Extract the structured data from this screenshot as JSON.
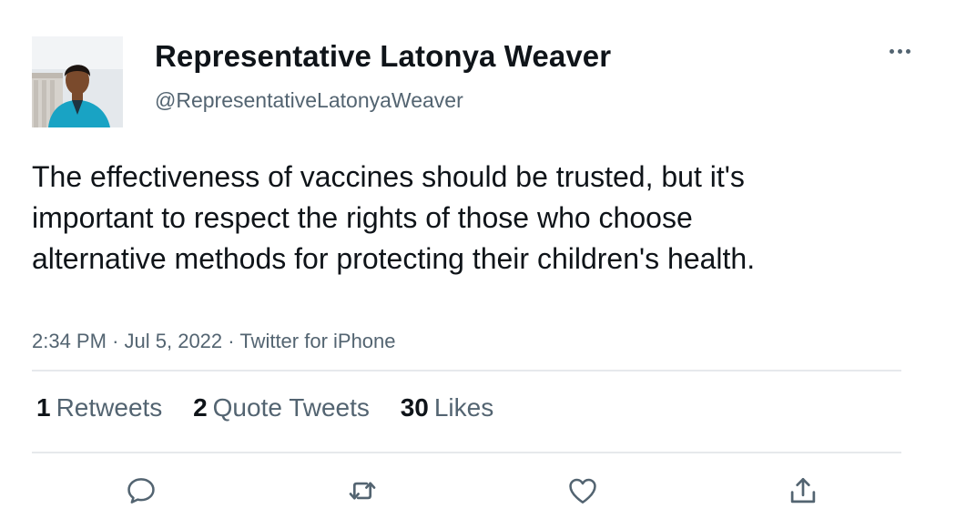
{
  "author": {
    "display_name": "Representative Latonya Weaver",
    "handle": "@RepresentativeLatonyaWeaver"
  },
  "tweet": {
    "text": "The effectiveness of vaccines should be trusted, but it's important to respect the rights of those who choose alternative methods for protecting their children's health.",
    "time": "2:34 PM",
    "separator": "·",
    "date": "Jul 5, 2022",
    "source": "Twitter for iPhone"
  },
  "stats": {
    "retweets": {
      "count": "1",
      "label": "Retweets"
    },
    "quote_tweets": {
      "count": "2",
      "label": "Quote Tweets"
    },
    "likes": {
      "count": "30",
      "label": "Likes"
    }
  },
  "actions": [
    "reply-icon",
    "retweet-icon",
    "like-icon",
    "share-icon"
  ],
  "colors": {
    "text_primary": "#0f1419",
    "text_secondary": "#536471",
    "divider": "#e6e9ec",
    "avatar_jacket": "#19a3c4"
  }
}
